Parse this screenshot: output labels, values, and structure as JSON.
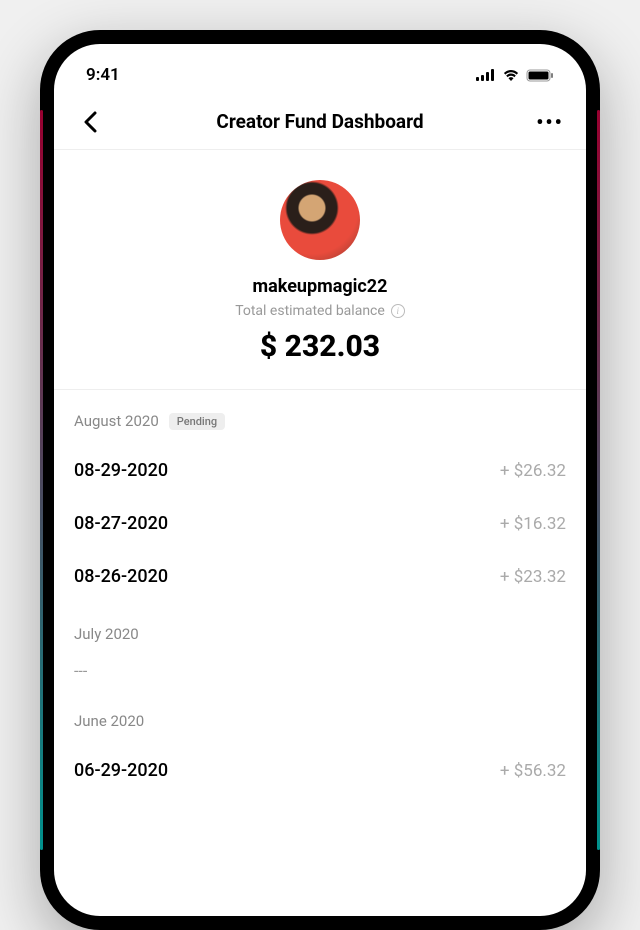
{
  "status": {
    "time": "9:41"
  },
  "header": {
    "title": "Creator Fund Dashboard"
  },
  "profile": {
    "username": "makeupmagic22",
    "balance_label": "Total estimated balance",
    "balance_amount": "$ 232.03"
  },
  "sections": [
    {
      "month": "August 2020",
      "status": "Pending",
      "rows": [
        {
          "date": "08-29-2020",
          "amount": "+ $26.32"
        },
        {
          "date": "08-27-2020",
          "amount": "+ $16.32"
        },
        {
          "date": "08-26-2020",
          "amount": "+ $23.32"
        }
      ]
    },
    {
      "month": "July 2020",
      "empty": "---"
    },
    {
      "month": "June 2020",
      "rows": [
        {
          "date": "06-29-2020",
          "amount": "+ $56.32"
        }
      ]
    }
  ]
}
